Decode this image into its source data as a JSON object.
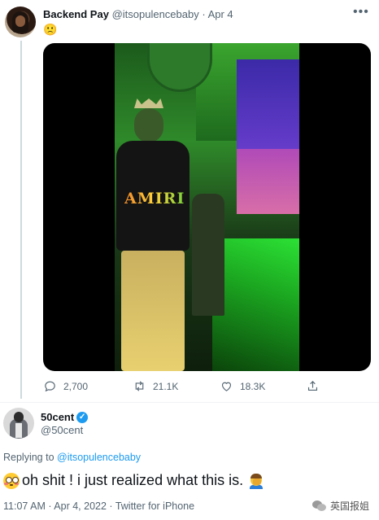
{
  "quoted_tweet": {
    "author_name": "Backend Pay",
    "author_handle": "@itsopulencebaby",
    "date": "Apr 4",
    "separator": " · ",
    "text": "🙁",
    "media": {
      "hoodie_print": "AMIRI"
    },
    "actions": {
      "replies": "2,700",
      "retweets": "21.1K",
      "likes": "18.3K"
    }
  },
  "main_tweet": {
    "author_name": "50cent",
    "author_handle": "@50cent",
    "verified": true,
    "replying_to_label": "Replying to ",
    "replying_to_handle": "@itsopulencebaby",
    "text": "oh shit ! i just realized what this is.",
    "timestamp": "11:07 AM · Apr 4, 2022 · Twitter for iPhone"
  },
  "watermark": {
    "text": "英国报姐"
  },
  "colors": {
    "accent": "#1d9bf0",
    "secondary_text": "#536471",
    "primary_text": "#0f1419"
  }
}
